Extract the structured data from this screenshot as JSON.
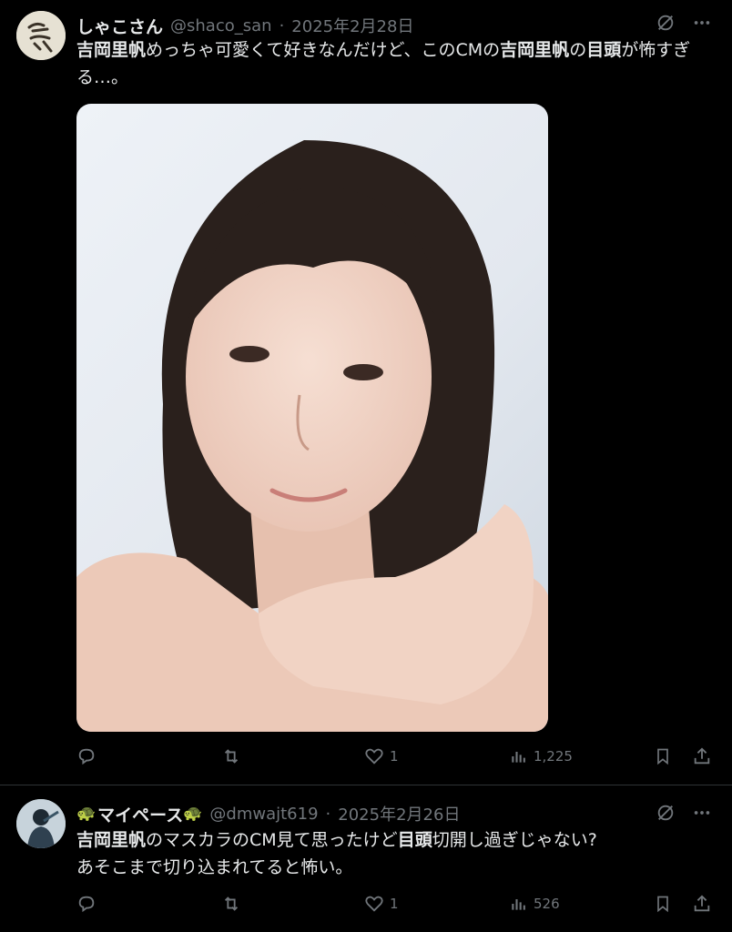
{
  "posts": [
    {
      "display_name": "しゃこさん",
      "handle": "@shaco_san",
      "separator": "·",
      "date": "2025年2月28日",
      "text_segments": [
        {
          "t": "吉岡里帆",
          "bold": true
        },
        {
          "t": "めっちゃ可愛くて好きなんだけど、このCMの",
          "bold": false
        },
        {
          "t": "吉岡里帆",
          "bold": true
        },
        {
          "t": "の",
          "bold": false
        },
        {
          "t": "目頭",
          "bold": true
        },
        {
          "t": "が怖すぎる…。",
          "bold": false
        }
      ],
      "stats": {
        "replies": "",
        "reposts": "",
        "likes": "1",
        "views": "1,225"
      }
    },
    {
      "display_name_prefix_icon": "🐢",
      "display_name": "マイペース",
      "display_name_suffix_icon": "🐢",
      "handle": "@dmwajt619",
      "separator": "·",
      "date": "2025年2月26日",
      "text_segments": [
        {
          "t": "吉岡里帆",
          "bold": true
        },
        {
          "t": "のマスカラのCM見て思ったけど",
          "bold": false
        },
        {
          "t": "目頭",
          "bold": true
        },
        {
          "t": "切開し過ぎじゃない?",
          "bold": false
        },
        {
          "t": "\nあそこまで切り込まれてると怖い。",
          "bold": false
        }
      ],
      "stats": {
        "replies": "",
        "reposts": "",
        "likes": "1",
        "views": "526"
      }
    }
  ],
  "icons": [
    "grok-icon",
    "more-icon",
    "reply-icon",
    "repost-icon",
    "like-icon",
    "views-icon",
    "bookmark-icon",
    "share-icon"
  ],
  "colors": {
    "background": "#000000",
    "text": "#e7e9ea",
    "muted": "#71767b",
    "divider": "#2f3336"
  }
}
